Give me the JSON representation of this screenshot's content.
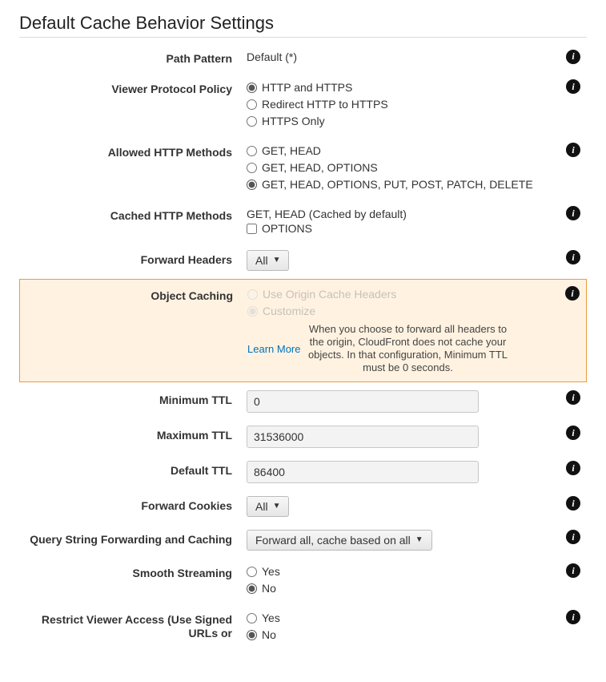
{
  "section_title": "Default Cache Behavior Settings",
  "rows": {
    "path_pattern": {
      "label": "Path Pattern",
      "value": "Default (*)"
    },
    "viewer_protocol": {
      "label": "Viewer Protocol Policy",
      "options": [
        {
          "label": "HTTP and HTTPS",
          "checked": true
        },
        {
          "label": "Redirect HTTP to HTTPS",
          "checked": false
        },
        {
          "label": "HTTPS Only",
          "checked": false
        }
      ]
    },
    "allowed_methods": {
      "label": "Allowed HTTP Methods",
      "options": [
        {
          "label": "GET, HEAD",
          "checked": false
        },
        {
          "label": "GET, HEAD, OPTIONS",
          "checked": false
        },
        {
          "label": "GET, HEAD, OPTIONS, PUT, POST, PATCH, DELETE",
          "checked": true
        }
      ]
    },
    "cached_methods": {
      "label": "Cached HTTP Methods",
      "default_text": "GET, HEAD (Cached by default)",
      "checkbox": {
        "label": "OPTIONS",
        "checked": false
      }
    },
    "forward_headers": {
      "label": "Forward Headers",
      "selected": "All"
    },
    "object_caching": {
      "label": "Object Caching",
      "options": [
        {
          "label": "Use Origin Cache Headers",
          "checked": false
        },
        {
          "label": "Customize",
          "checked": true
        }
      ],
      "learn_more": "Learn More",
      "note": "When you choose to forward all headers to the origin, CloudFront does not cache your objects. In that configuration, Minimum TTL must be 0 seconds."
    },
    "minimum_ttl": {
      "label": "Minimum TTL",
      "value": "0"
    },
    "maximum_ttl": {
      "label": "Maximum TTL",
      "value": "31536000"
    },
    "default_ttl": {
      "label": "Default TTL",
      "value": "86400"
    },
    "forward_cookies": {
      "label": "Forward Cookies",
      "selected": "All"
    },
    "query_string": {
      "label": "Query String Forwarding and Caching",
      "selected": "Forward all, cache based on all"
    },
    "smooth_streaming": {
      "label": "Smooth Streaming",
      "options": [
        {
          "label": "Yes",
          "checked": false
        },
        {
          "label": "No",
          "checked": true
        }
      ]
    },
    "restrict_viewer": {
      "label": "Restrict Viewer Access (Use Signed URLs or",
      "options": [
        {
          "label": "Yes",
          "checked": false
        },
        {
          "label": "No",
          "checked": true
        }
      ]
    }
  }
}
